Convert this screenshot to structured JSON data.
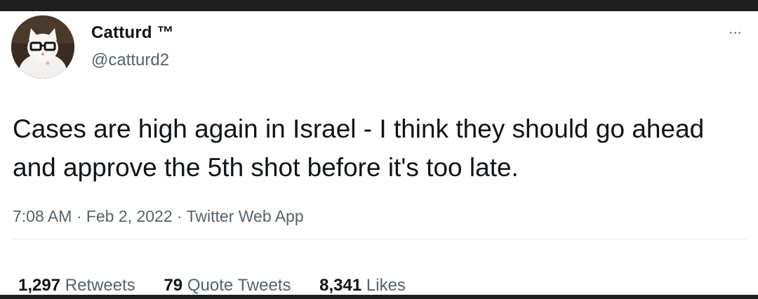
{
  "user": {
    "display_name": "Catturd ™",
    "handle": "@catturd2"
  },
  "menu": {
    "more_label": "···",
    "more_icon": "more-horizontal-icon"
  },
  "tweet": {
    "text": "Cases are high again in Israel - I think they should go ahead and approve the 5th shot before it's too late."
  },
  "meta": {
    "time": "7:08 AM",
    "sep1": " · ",
    "date": "Feb 2, 2022",
    "sep2": " · ",
    "source": "Twitter Web App"
  },
  "stats": {
    "retweets_count": "1,297",
    "retweets_label": "Retweets",
    "quotes_count": "79",
    "quotes_label": "Quote Tweets",
    "likes_count": "8,341",
    "likes_label": "Likes"
  },
  "colors": {
    "text_primary": "#0f1419",
    "text_secondary": "#536471",
    "divider": "#e6ecf0"
  }
}
